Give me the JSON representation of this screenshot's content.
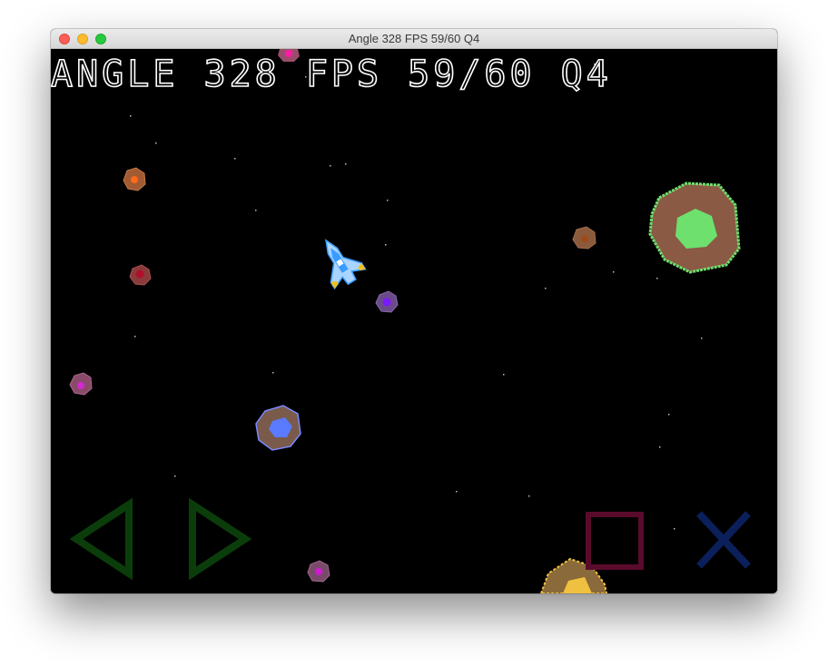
{
  "window": {
    "title": "Angle 328 FPS 59/60 Q4"
  },
  "hud": {
    "text": "ANGLE 328 FPS 59/60 Q4",
    "angle": 328,
    "fps": "59/60",
    "quadrant": "Q4"
  },
  "ship": {
    "angle_degrees": 328,
    "colors": {
      "hull": "#a8d4ff",
      "body": "#3b9cff",
      "accent": "#f0c020"
    }
  },
  "controls": {
    "rotate_left": {
      "icon": "left-triangle-icon",
      "color": "#0b3d0b"
    },
    "rotate_right": {
      "icon": "right-triangle-icon",
      "color": "#0b3d0b"
    },
    "square_button": {
      "icon": "square-icon",
      "color": "#5a0b2c"
    },
    "cross_button": {
      "icon": "cross-icon",
      "color": "#0b1f5a"
    }
  },
  "asteroids": [
    {
      "name": "asteroid-magenta-top",
      "outer": "#9a4d6a",
      "inner": "#ff1aa8"
    },
    {
      "name": "asteroid-orange",
      "outer": "#a15a32",
      "inner": "#ff6a1a"
    },
    {
      "name": "asteroid-red",
      "outer": "#8a3a3a",
      "inner": "#b0102a"
    },
    {
      "name": "asteroid-purple",
      "outer": "#6a4a8a",
      "inner": "#7a1aff"
    },
    {
      "name": "asteroid-pink-left",
      "outer": "#8a4a6a",
      "inner": "#d02ad0"
    },
    {
      "name": "asteroid-blue",
      "outer": "#7a5a4a",
      "inner": "#5a7aff"
    },
    {
      "name": "asteroid-brown-small",
      "outer": "#8a5a3a",
      "inner": "#a04a1a"
    },
    {
      "name": "asteroid-green-large",
      "outer": "#8a5a44",
      "inner": "#6ee06e"
    },
    {
      "name": "asteroid-magenta-bottom",
      "outer": "#7a4a6a",
      "inner": "#d01ad0"
    },
    {
      "name": "asteroid-yellow-bottom",
      "outer": "#8a6a3a",
      "inner": "#f0c040"
    }
  ]
}
